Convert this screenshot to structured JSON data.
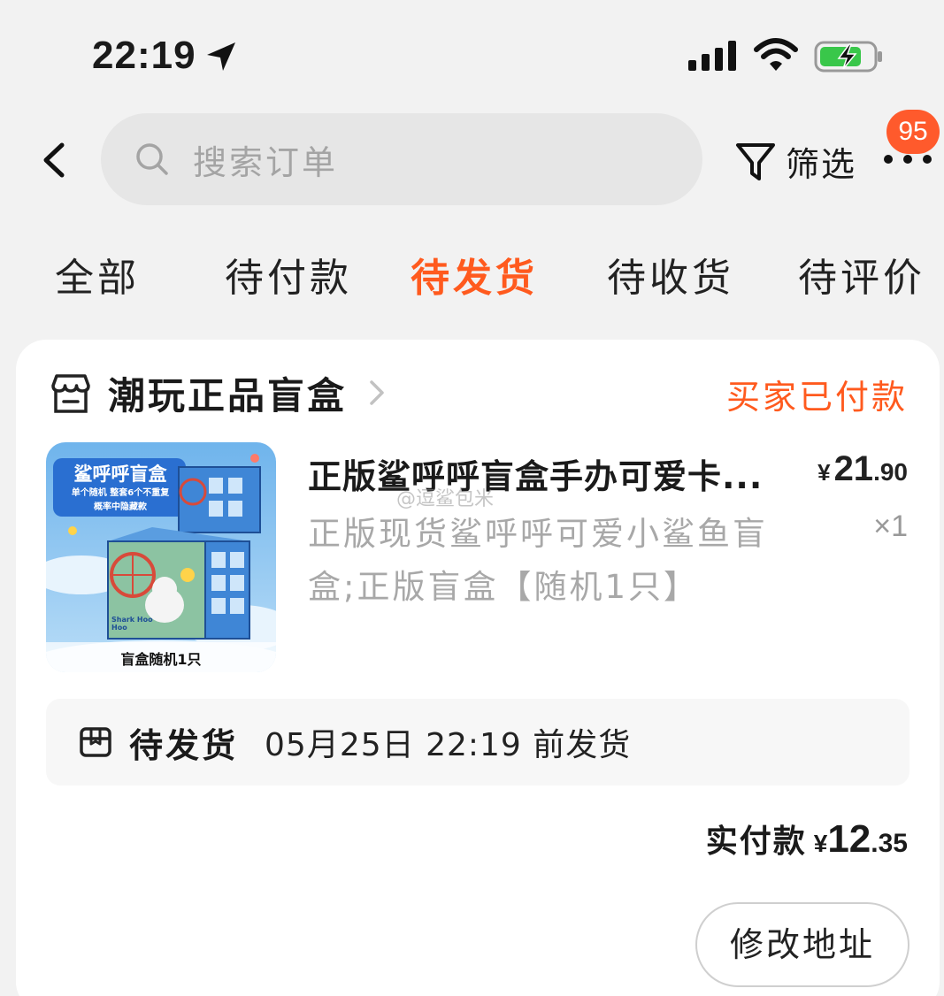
{
  "status_bar": {
    "time": "22:19",
    "icons": [
      "location-arrow-icon",
      "signal-icon",
      "wifi-icon",
      "battery-charging-icon"
    ]
  },
  "header": {
    "back_icon": "chevron-left-icon",
    "search_placeholder": "搜索订单",
    "filter_label": "筛选",
    "more_icon": "more-dots-icon",
    "badge_count": "95"
  },
  "tabs": [
    {
      "label": "全部",
      "active": false
    },
    {
      "label": "待付款",
      "active": false
    },
    {
      "label": "待发货",
      "active": true
    },
    {
      "label": "待收货",
      "active": false
    },
    {
      "label": "待评价",
      "active": false
    }
  ],
  "order": {
    "shop_name": "潮玩正品盲盒",
    "status": "买家已付款",
    "product": {
      "title": "正版鲨呼呼盲盒手办可爱卡...",
      "spec": "正版现货鲨呼呼可爱小鲨鱼盲盒;正版盲盒【随机1只】",
      "price_currency": "¥",
      "price_int": "21",
      "price_dec": ".90",
      "quantity": "×1",
      "image": {
        "banner_title": "鲨呼呼盲盒",
        "banner_sub1": "单个随机 整套6个不重复",
        "banner_sub2": "概率中隐藏款",
        "box_label": "Shark Hoo Hoo",
        "footer_label": "盲盒随机1只"
      }
    },
    "watermark": "@逗鲨包米",
    "shipping": {
      "status": "待发货",
      "deadline": "05月25日 22:19 前发货"
    },
    "paid": {
      "label": "实付款",
      "currency": "¥",
      "int": "12",
      "dec": ".35"
    },
    "action_button": "修改地址"
  },
  "colors": {
    "accent": "#ff5a1e",
    "badge": "#ff5a2c",
    "background": "#f2f2f2",
    "search_bg": "#e6e6e6"
  }
}
